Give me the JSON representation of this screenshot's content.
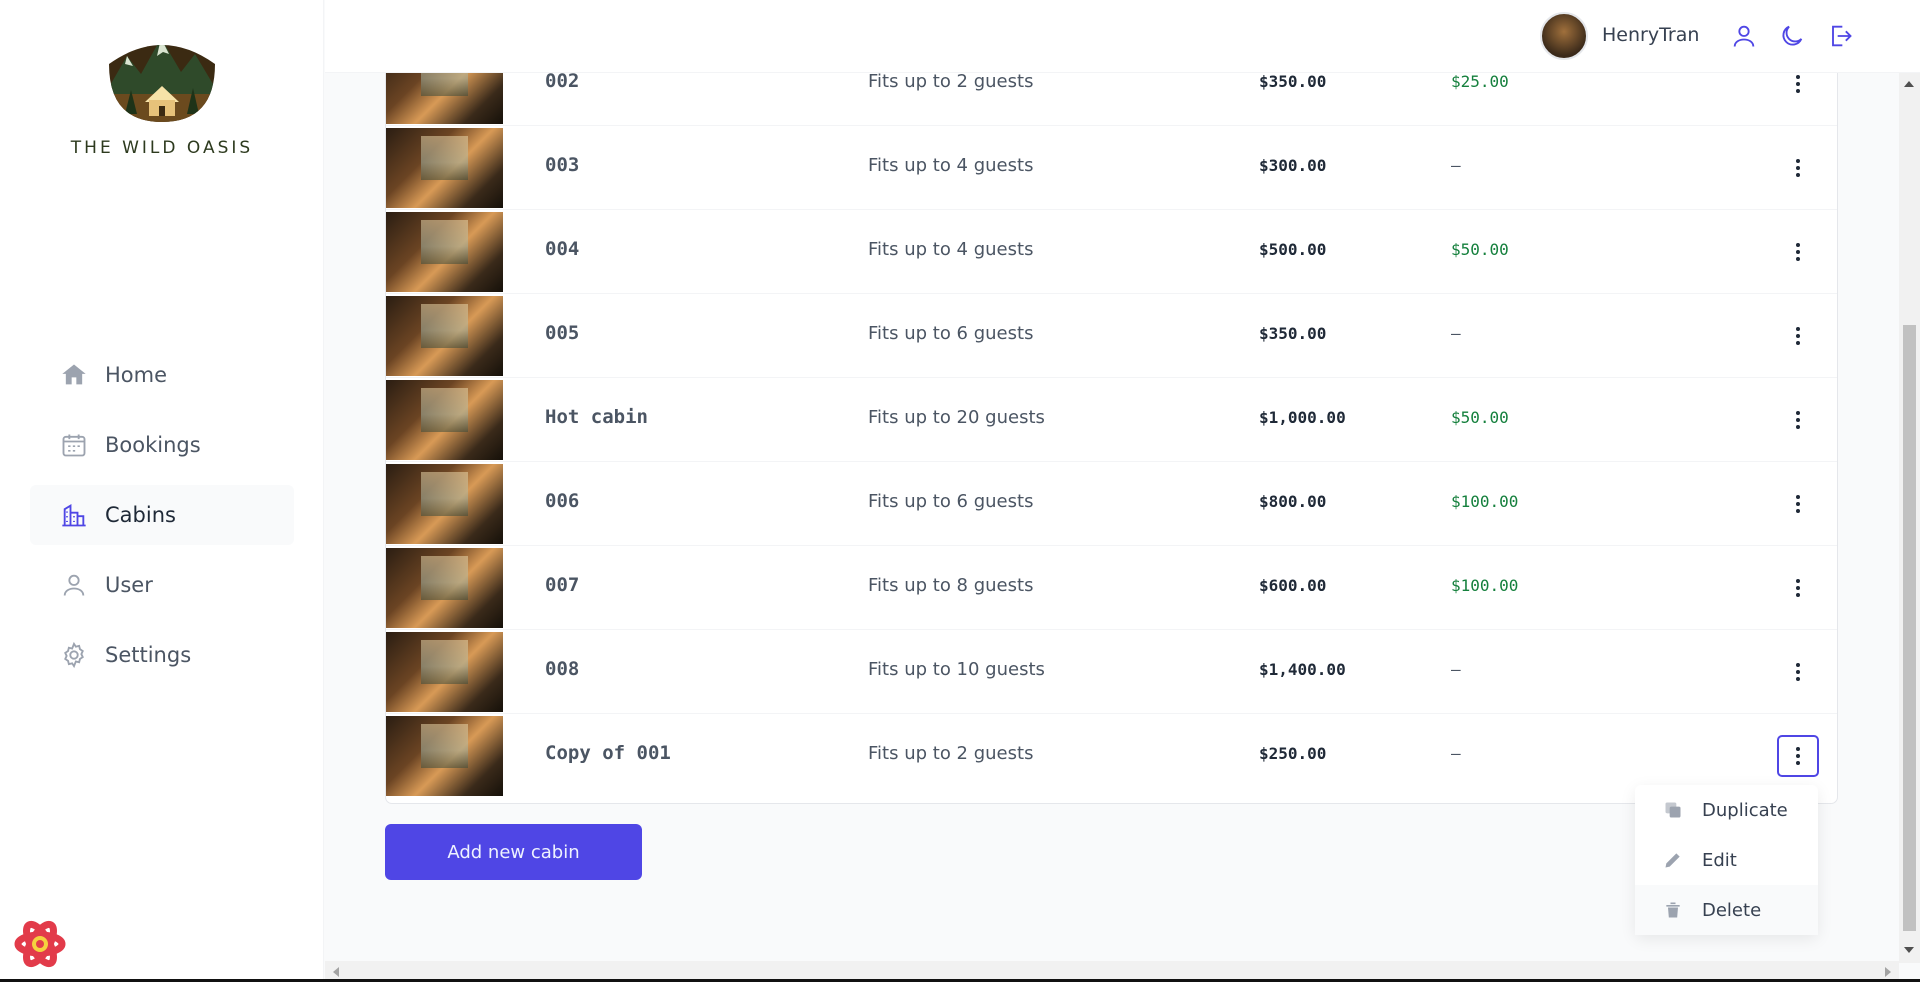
{
  "app": {
    "name": "THE WILD OASIS"
  },
  "sidebar": {
    "items": [
      {
        "label": "Home",
        "icon": "home-icon",
        "active": false
      },
      {
        "label": "Bookings",
        "icon": "calendar-icon",
        "active": false
      },
      {
        "label": "Cabins",
        "icon": "buildings-icon",
        "active": true
      },
      {
        "label": "User",
        "icon": "user-icon",
        "active": false
      },
      {
        "label": "Settings",
        "icon": "gear-icon",
        "active": false
      }
    ]
  },
  "header": {
    "user_name": "HenryTran",
    "icons": [
      "user-icon",
      "moon-icon",
      "logout-icon"
    ]
  },
  "cabins": [
    {
      "name": "002",
      "capacity": "Fits up to 2 guests",
      "price": "$350.00",
      "discount": "$25.00"
    },
    {
      "name": "003",
      "capacity": "Fits up to 4 guests",
      "price": "$300.00",
      "discount": "—"
    },
    {
      "name": "004",
      "capacity": "Fits up to 4 guests",
      "price": "$500.00",
      "discount": "$50.00"
    },
    {
      "name": "005",
      "capacity": "Fits up to 6 guests",
      "price": "$350.00",
      "discount": "—"
    },
    {
      "name": "Hot cabin",
      "capacity": "Fits up to 20 guests",
      "price": "$1,000.00",
      "discount": "$50.00"
    },
    {
      "name": "006",
      "capacity": "Fits up to 6 guests",
      "price": "$800.00",
      "discount": "$100.00"
    },
    {
      "name": "007",
      "capacity": "Fits up to 8 guests",
      "price": "$600.00",
      "discount": "$100.00"
    },
    {
      "name": "008",
      "capacity": "Fits up to 10 guests",
      "price": "$1,400.00",
      "discount": "—"
    },
    {
      "name": "Copy of 001",
      "capacity": "Fits up to 2 guests",
      "price": "$250.00",
      "discount": "—"
    }
  ],
  "actions": {
    "add_cabin": "Add new cabin",
    "menu": [
      {
        "label": "Duplicate",
        "icon": "duplicate-icon"
      },
      {
        "label": "Edit",
        "icon": "pencil-icon"
      },
      {
        "label": "Delete",
        "icon": "trash-icon"
      }
    ]
  },
  "colors": {
    "brand": "#4f46e5",
    "discount": "#15803d",
    "text": "#374151"
  }
}
